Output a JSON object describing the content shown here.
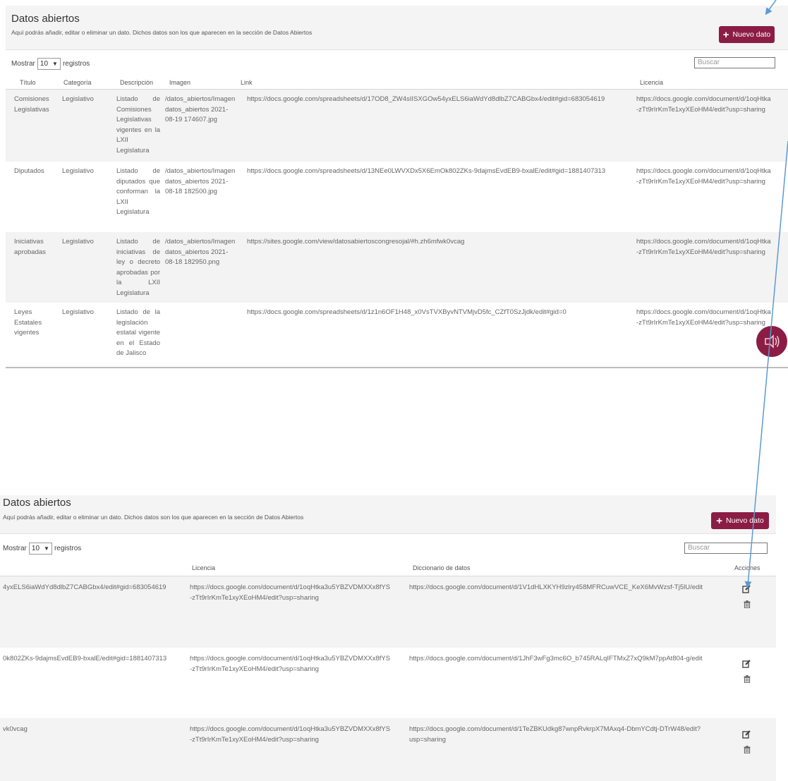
{
  "page": {
    "title": "Datos abiertos",
    "subtitle": "Aquí podrás añadir, editar o eliminar un dato. Dichos datos son los que aparecen en la sección de Datos Abiertos",
    "new_button": "Nuevo dato",
    "show_label": "Mostrar",
    "show_value": "10",
    "records_label": "registros",
    "search_placeholder": "Buscar"
  },
  "columns": {
    "titulo": "Título",
    "categoria": "Categoría",
    "descripcion": "Descripción",
    "imagen": "Imagen",
    "link": "Link",
    "licencia": "Licencia",
    "diccionario": "Diccionario de datos",
    "acciones": "Acciones"
  },
  "rows": [
    {
      "titulo": "Comisiones Legislativas",
      "categoria": "Legislativo",
      "descripcion": "Listado de Comisiones Legislativas vigentes en la LXII Legislatura",
      "imagen": "/datos_abiertos/Imagen datos_abiertos 2021-08-19 174607.jpg",
      "link": "https://docs.google.com/spreadsheets/d/17OD8_ZW4sIISXGOw54yxELS6iaWdYd8dlbZ7CABGbx4/edit#gid=683054619",
      "link_tail": "4yxELS6iaWdYd8dlbZ7CABGbx4/edit#gid=683054619",
      "licencia_1": "https://docs.google.com/document/d/1oqHtka3u5YBZVDMXXx8fYS",
      "licencia_1_cut": "https://docs.google.com/document/d/1oqHtka",
      "licencia_2": "-zTt9rIrKmTe1xyXEoHM4/edit?usp=sharing",
      "diccionario_1": "https://docs.google.com/document/d/1V1dHLXKYH9zlry458MFRCuwVCE_KeX6MvWzsf-Tj5lU/edit",
      "diccionario_2": ""
    },
    {
      "titulo": "Diputados",
      "categoria": "Legislativo",
      "descripcion": "Listado de diputados que conforman la LXII Legislatura",
      "imagen": "/datos_abiertos/Imagen datos_abiertos 2021-08-18 182500.jpg",
      "link": "https://docs.google.com/spreadsheets/d/13NEe0LWVXDx5X6EmOk802ZKs-9dajmsEvdEB9-bxalE/edit#gid=1881407313",
      "link_tail": "0k802ZKs-9dajmsEvdEB9-bxalE/edit#gid=1881407313",
      "licencia_1": "https://docs.google.com/document/d/1oqHtka3u5YBZVDMXXx8fYS",
      "licencia_1_cut": "https://docs.google.com/document/d/1oqHtka",
      "licencia_2": "-zTt9rIrKmTe1xyXEoHM4/edit?usp=sharing",
      "diccionario_1": "https://docs.google.com/document/d/1JhF3wFg3mc6O_b745RALqIFTMxZ7xQ9kM7ppAt804-g/edit",
      "diccionario_2": ""
    },
    {
      "titulo": "Iniciativas aprobadas",
      "categoria": "Legislativo",
      "descripcion": "Listado de iniciativas de ley o decreto aprobadas por la LXII Legislatura",
      "imagen": "/datos_abiertos/Imagen datos_abiertos 2021-08-18 182950.png",
      "link": "https://sites.google.com/view/datosabiertoscongresojal/#h.zh6mfwk0vcag",
      "link_tail": "vk0vcag",
      "licencia_1": "https://docs.google.com/document/d/1oqHtka3u5YBZVDMXXx8fYS",
      "licencia_1_cut": "https://docs.google.com/document/d/1oqHtka",
      "licencia_2": "-zTt9rIrKmTe1xyXEoHM4/edit?usp=sharing",
      "diccionario_1": "https://docs.google.com/document/d/1TeZBKUdkg87wnpRvkrpX7MAxq4-DbmYCdtj-DTrW48/edit?",
      "diccionario_2": "usp=sharing"
    },
    {
      "titulo": "Leyes Estatales vigentes",
      "categoria": "Legislativo",
      "descripcion": "Listado de la legislación estatal vigente en el Estado de Jalisco",
      "imagen": "",
      "link": "https://docs.google.com/spreadsheets/d/1z1n6OF1H48_x0VsTVXByvNTVMjvD5fc_CZfT0SzJjdk/edit#gid=0",
      "licencia_1": "https://docs.google.com/document/d/1oqHtka3u5YBZVDMXXx8fYS",
      "licencia_1_cut": "https://docs.google.com/document/d/1oqHtka",
      "licencia_2": "-zTt9rIrKmTe1xyXEoHM4/edit?usp=sharing"
    }
  ],
  "colors": {
    "accent": "#8b1d44",
    "arrow": "#5b9bd5",
    "row_shade": "#f3f3f3"
  },
  "icons": {
    "edit": "edit-icon",
    "delete": "trash-icon",
    "fab": "help-icon"
  }
}
